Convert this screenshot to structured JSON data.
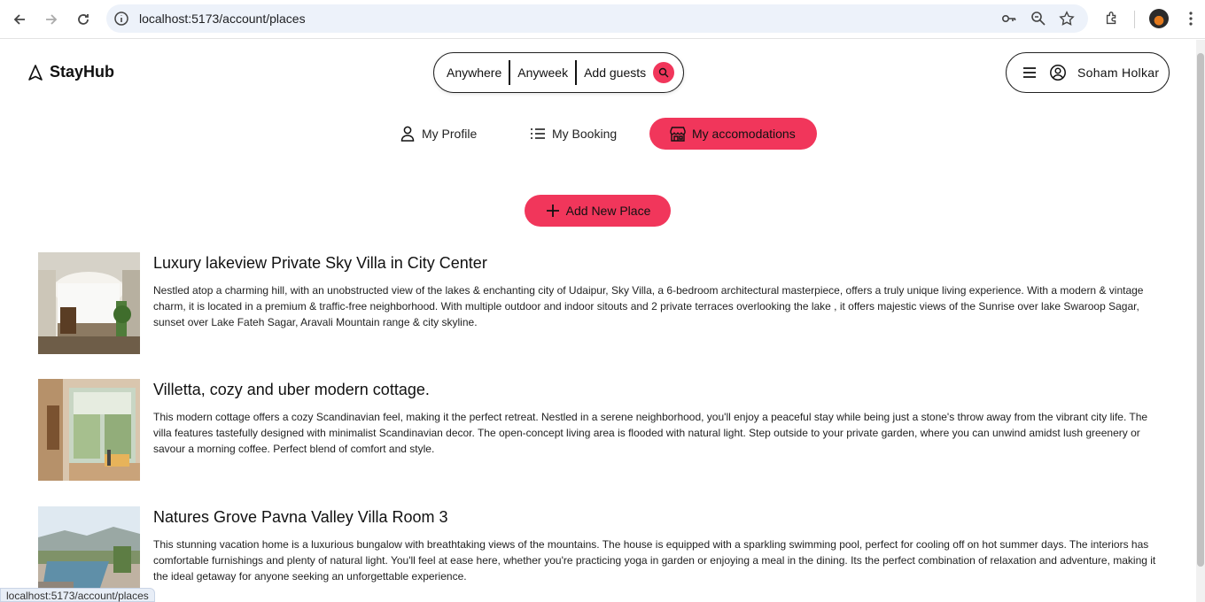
{
  "browser": {
    "url": "localhost:5173/account/places",
    "status_url": "localhost:5173/account/places"
  },
  "header": {
    "logo_text": "StayHub",
    "search": {
      "anywhere": "Anywhere",
      "anyweek": "Anyweek",
      "guests": "Add guests"
    },
    "user_name": "Soham Holkar"
  },
  "tabs": [
    {
      "label": "My Profile",
      "icon": "user-icon",
      "active": false
    },
    {
      "label": "My Booking",
      "icon": "list-icon",
      "active": false
    },
    {
      "label": "My accomodations",
      "icon": "building-icon",
      "active": true
    }
  ],
  "add_button": "Add New Place",
  "places": [
    {
      "title": "Luxury lakeview Private Sky Villa in City Center",
      "description": "Nestled atop a charming hill, with an unobstructed view of the lakes & enchanting city of Udaipur, Sky Villa, a 6-bedroom architectural masterpiece, offers a truly unique living experience. With a modern & vintage charm, it is located in a premium & traffic-free neighborhood. With multiple outdoor and indoor sitouts and 2 private terraces overlooking the lake , it offers majestic views of the Sunrise over lake Swaroop Sagar, sunset over Lake Fateh Sagar, Aravali Mountain range & city skyline."
    },
    {
      "title": "Villetta, cozy and uber modern cottage.",
      "description": "This modern cottage offers a cozy Scandinavian feel, making it the perfect retreat. Nestled in a serene neighborhood, you'll enjoy a peaceful stay while being just a stone's throw away from the vibrant city life. The villa features tastefully designed with minimalist Scandinavian decor. The open-concept living area is flooded with natural light. Step outside to your private garden, where you can unwind amidst lush greenery or savour a morning coffee. Perfect blend of comfort and style."
    },
    {
      "title": "Natures Grove Pavna Valley Villa Room 3",
      "description": "This stunning vacation home is a luxurious bungalow with breathtaking views of the mountains. The house is equipped with a sparkling swimming pool, perfect for cooling off on hot summer days. The interiors has comfortable furnishings and plenty of natural light. You'll feel at ease here, whether you're practicing yoga in garden or enjoying a meal in the dining. Its the perfect combination of relaxation and adventure, making it the ideal getaway for anyone seeking an unforgettable experience."
    }
  ],
  "colors": {
    "accent": "#f1365b"
  }
}
